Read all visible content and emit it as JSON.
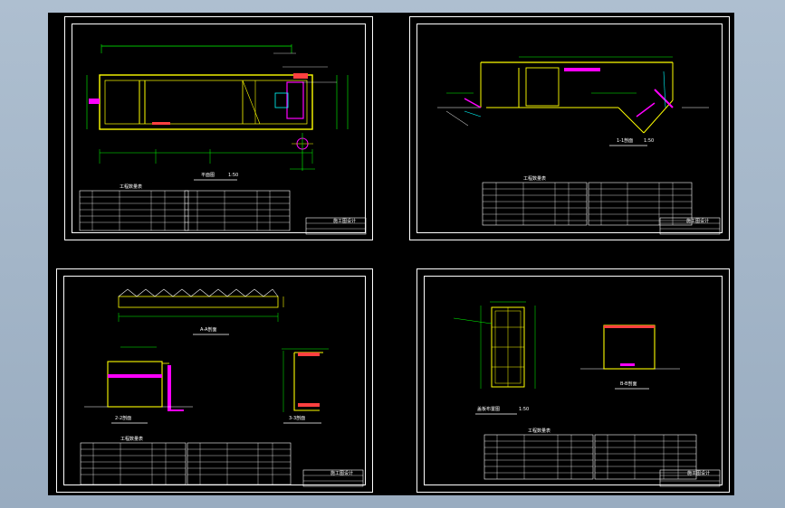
{
  "colors": {
    "background": "#a8bacb",
    "canvas": "#000000",
    "frame": "#ffffff",
    "structure": "#ffff00",
    "dimension": "#00ff00",
    "pipe": "#ff00ff",
    "annotation": "#00ffff",
    "accent": "#ff4040"
  },
  "sheets": [
    {
      "id": "sheet-1",
      "view_title": "平面图",
      "scale": "1:50"
    },
    {
      "id": "sheet-2",
      "view_title": "1-1剖面",
      "scale": "1:50"
    },
    {
      "id": "sheet-3",
      "view_title": "2-2剖面",
      "view_title_b": "3-3剖面",
      "view_title_c": "A-A剖面",
      "scale": "1:50"
    },
    {
      "id": "sheet-4",
      "view_title": "盖板布置图",
      "view_title_b": "B-B剖面",
      "scale": "1:50"
    }
  ],
  "tables": {
    "title": "工程数量表"
  },
  "title_block": {
    "label": "施工图设计"
  }
}
